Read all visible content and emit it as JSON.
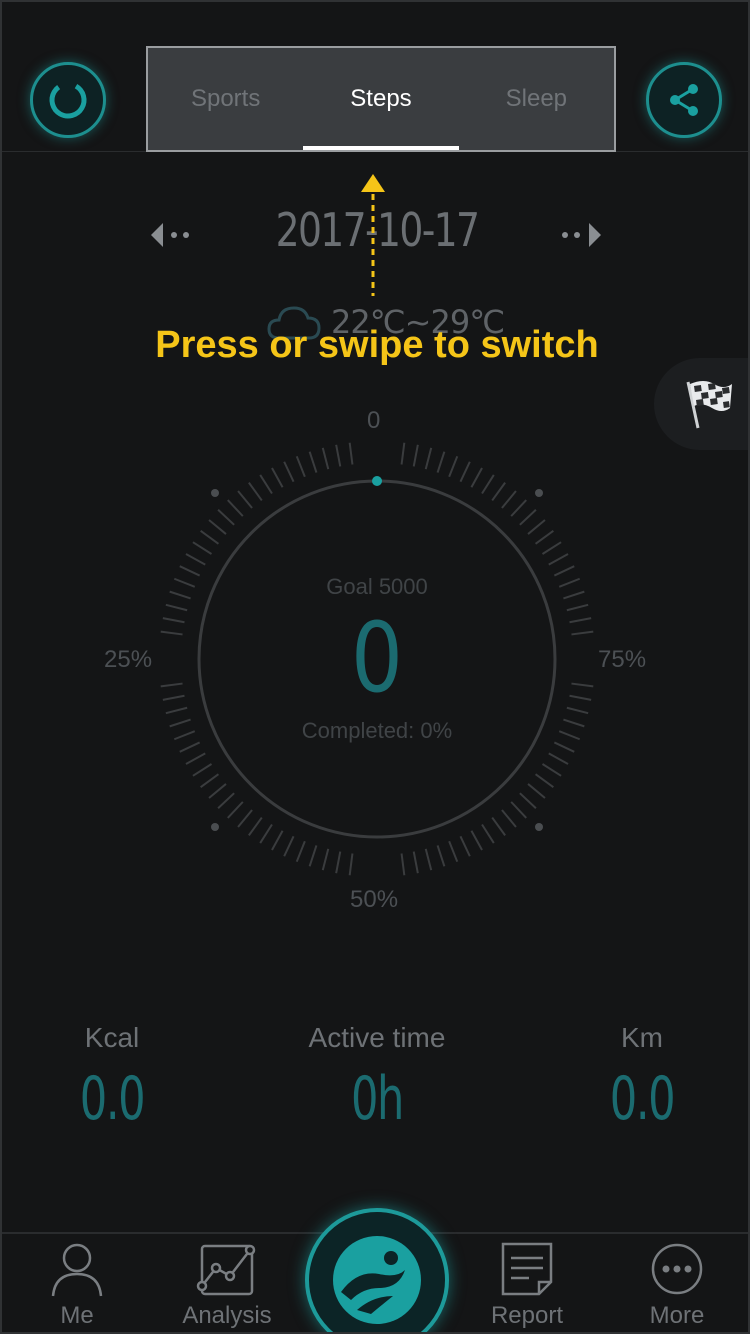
{
  "header": {
    "left_button_icon": "sync-ring-icon",
    "right_button_icon": "share-icon",
    "tabs": [
      {
        "label": "Sports"
      },
      {
        "label": "Steps"
      },
      {
        "label": "Sleep"
      }
    ],
    "active_tab": "Steps"
  },
  "date": {
    "value": "2017-10-17",
    "prev_icon": "prev-arrow-icon",
    "next_icon": "next-arrow-icon"
  },
  "weather": {
    "icon": "cloud-icon",
    "text": "22℃~29℃"
  },
  "hint": {
    "text": "Press or swipe to switch",
    "color": "#f5c518"
  },
  "gauge": {
    "label_top": "0",
    "label_left": "25%",
    "label_right": "75%",
    "label_bottom": "50%",
    "goal": "Goal 5000",
    "steps": "0",
    "completed": "Completed: 0%",
    "progress": 0
  },
  "stats": [
    {
      "label": "Kcal",
      "value": "0.0"
    },
    {
      "label": "Active time",
      "value": "0h"
    },
    {
      "label": "Km",
      "value": "0.0"
    }
  ],
  "nav": {
    "me": "Me",
    "analysis": "Analysis",
    "report": "Report",
    "more": "More"
  },
  "colors": {
    "accent": "#1d8f8f",
    "value": "#1b6b70",
    "background": "#141516"
  }
}
